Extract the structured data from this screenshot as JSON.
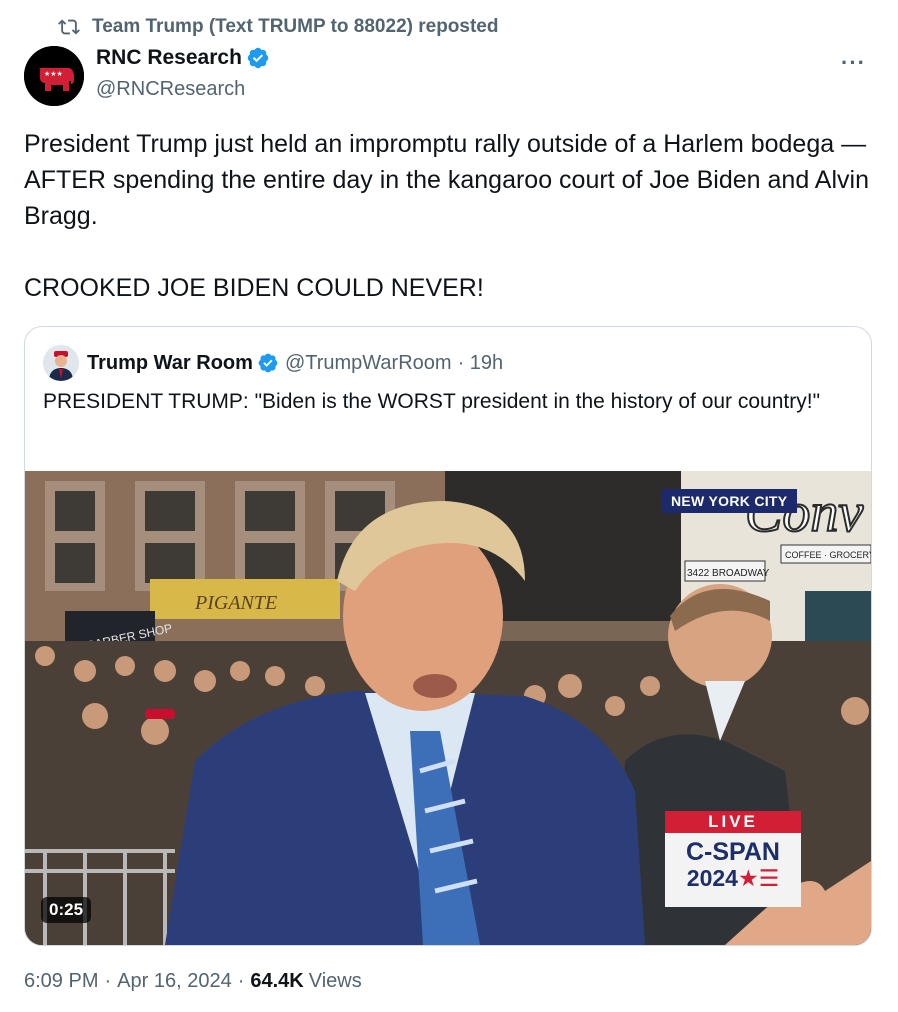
{
  "repost": {
    "text": "Team Trump (Text TRUMP to 88022) reposted",
    "icon": "repost-icon"
  },
  "author": {
    "name": "RNC Research",
    "handle": "@RNCResearch",
    "verified": true,
    "badge_color": "#1d9bf0"
  },
  "more_label": "···",
  "tweet": {
    "paragraph1": "President Trump just held an impromptu rally outside of a Harlem bodega — AFTER spending the entire day in the kangaroo court of Joe Biden and Alvin Bragg.",
    "paragraph2": "CROOKED JOE BIDEN COULD NEVER!"
  },
  "quote": {
    "name": "Trump War Room",
    "handle": "@TrumpWarRoom",
    "time": "· 19h",
    "verified": true,
    "text": "PRESIDENT TRUMP: \"Biden is the WORST president in the history of our country!\""
  },
  "video": {
    "duration": "0:25",
    "location_tag": "NEW YORK CITY",
    "broadcast_live": "LIVE",
    "broadcast_name": "C-SPAN",
    "broadcast_year": "2024",
    "broadcast_star": "★☰",
    "storefront_signs": [
      "BARBER SHOP",
      "3422 BROADWAY",
      "COFFEE · GROCERY · BE",
      "CONV",
      "PIGANTE"
    ]
  },
  "footer": {
    "time": "6:09 PM",
    "date": "Apr 16, 2024",
    "views_count": "64.4K",
    "views_label": "Views",
    "separator": "·"
  },
  "colors": {
    "text": "#0f1419",
    "muted": "#536471",
    "border": "#cfd9de",
    "verified": "#1d9bf0",
    "rnc_red": "#d21f35",
    "cspan_blue": "#1c2f6b"
  }
}
